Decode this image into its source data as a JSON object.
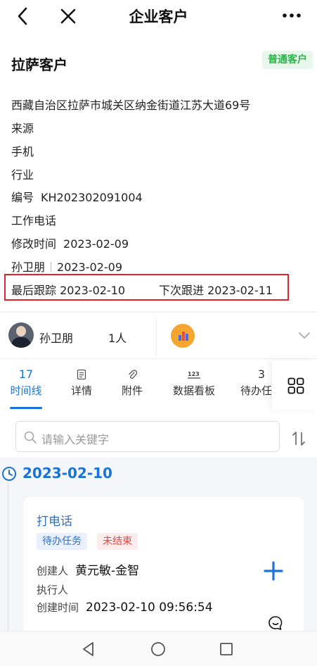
{
  "header": {
    "title": "企业客户",
    "back_icon": "back-arrow-icon",
    "close_icon": "close-icon",
    "more_icon": "more-dots-icon"
  },
  "customer": {
    "name": "拉萨客户",
    "type_badge": "普通客户",
    "address": "西藏自治区拉萨市城关区纳金街道江苏大道69号",
    "source_label": "来源",
    "phone_label": "手机",
    "industry_label": "行业",
    "number_label": "编号",
    "number_value": "KH202302091004",
    "work_phone_label": "工作电话",
    "modified_label": "修改时间",
    "modified_value": "2023-02-09",
    "creator_name": "孙卫朋",
    "created_value": "2023-02-09",
    "last_follow": "最后跟踪 2023-02-10",
    "next_follow": "下次跟进 2023-02-11"
  },
  "owner": {
    "name": "孙卫朋",
    "count": "1人"
  },
  "tabs": [
    {
      "top": "17",
      "label": "时间线",
      "active": true
    },
    {
      "top": "",
      "label": "详情",
      "icon": "document-icon"
    },
    {
      "top": "",
      "label": "附件",
      "icon": "paperclip-icon"
    },
    {
      "top": "",
      "label": "数据看板",
      "icon": "numbers-icon"
    },
    {
      "top": "3",
      "label": "待办任务"
    }
  ],
  "search": {
    "placeholder": "请输入关键字"
  },
  "timeline": {
    "date": "2023-02-10",
    "card": {
      "title": "打电话",
      "tag_todo": "待办任务",
      "tag_status": "未结束",
      "creator_label": "创建人",
      "creator_value": "黄元敏-金智",
      "executor_label": "执行人",
      "created_time_label": "创建时间",
      "created_time_value": "2023-02-10 09:56:54"
    }
  },
  "colors": {
    "accent": "#1a73d9",
    "badge_green": "#2bb34a",
    "highlight_red": "#e0222b",
    "tag_red": "#e04848"
  }
}
